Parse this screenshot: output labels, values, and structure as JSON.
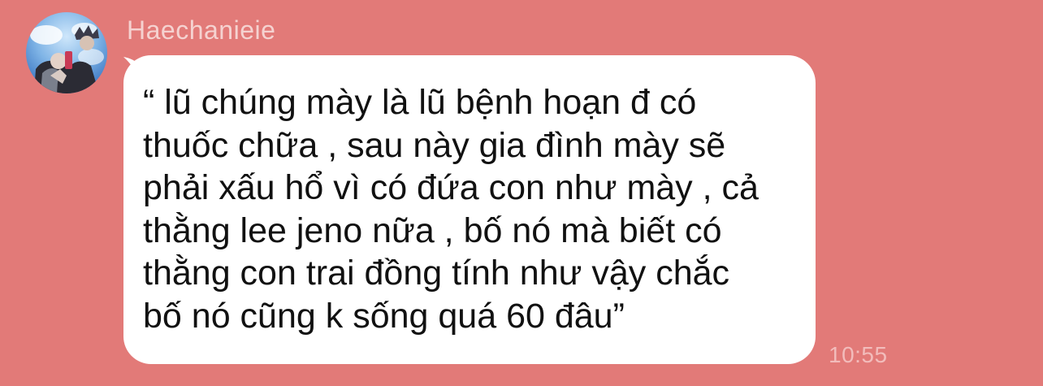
{
  "message": {
    "sender": "Haechanieie",
    "avatar_icon": "profile-photo-avatar",
    "text": "“ lũ chúng mày là lũ bệnh hoạn đ có\nthuốc chữa , sau này gia đình mày sẽ\nphải xấu hổ vì có đứa con như mày , cả\nthằng lee jeno nữa , bố nó mà biết có\nthằng con trai đồng tính như vậy chắc\nbố nó cũng k sống quá 60 đâu”",
    "time": "10:55"
  },
  "colors": {
    "background": "#e27a78",
    "bubble": "#ffffff",
    "sender_name": "#f5d2d0",
    "timestamp": "#f2bcbb",
    "text": "#111111"
  }
}
